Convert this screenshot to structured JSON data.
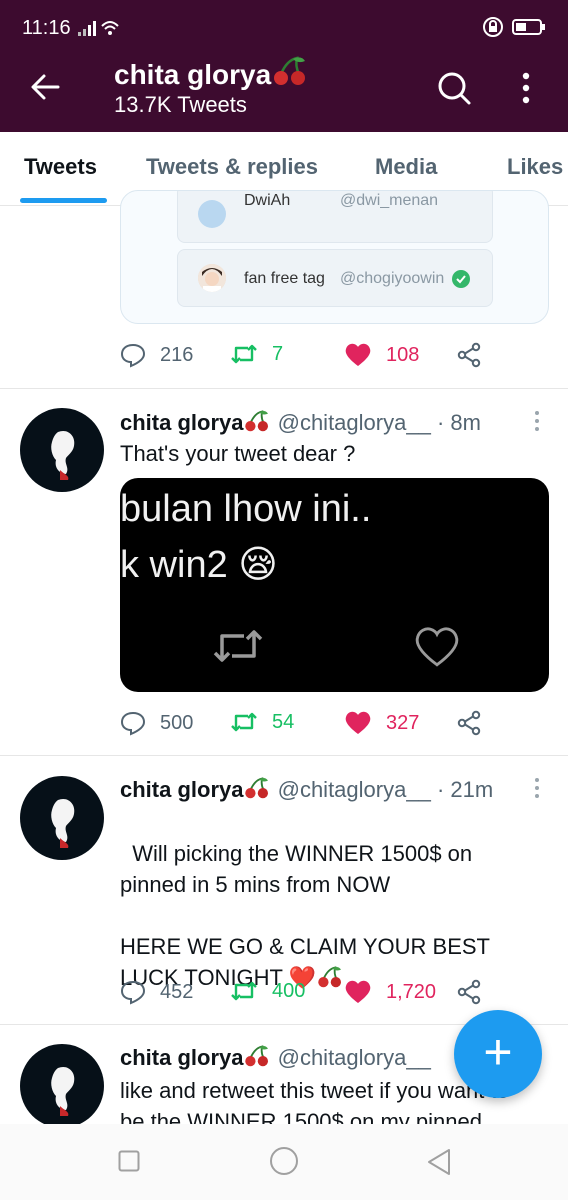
{
  "status": {
    "time": "11:16"
  },
  "header": {
    "title": "chita glorya",
    "tweet_count": "13.7K Tweets"
  },
  "tabs": [
    "Tweets",
    "Tweets & replies",
    "Media",
    "Likes"
  ],
  "quoted_card": {
    "top_partial_name": "DwiAh",
    "top_partial_handle": "@dwi_menan",
    "tag_name": "fan free tag",
    "tag_handle": "@chogiyoowin"
  },
  "tweets": [
    {
      "replies": "216",
      "retweets": "7",
      "likes": "108"
    },
    {
      "name": "chita glorya",
      "handle": "@chitaglorya__",
      "time": "· 8m",
      "text": "That's your tweet dear ?",
      "media_line1": "bulan lhow ini..",
      "media_line2": "k win2 😪",
      "replies": "500",
      "retweets": "54",
      "likes": "327"
    },
    {
      "name": "chita glorya",
      "handle": "@chitaglorya__",
      "time": "· 21m",
      "text": "Will picking the WINNER 1500$ on pinned in 5 mins from NOW\n\nHERE WE GO & CLAIM YOUR BEST LUCK TONIGHT ❤️",
      "replies": "452",
      "retweets": "400",
      "likes": "1,720"
    },
    {
      "name": "chita glorya",
      "handle": "@chitaglorya__",
      "text": "like and retweet this tweet if you want to be the WINNER 1500$ on my pinned"
    }
  ],
  "fab": {
    "label": "+"
  },
  "colors": {
    "header_bg": "#3d0b2f",
    "accent": "#1d9bf0",
    "retweet": "#17bf63",
    "like": "#e0245e"
  }
}
